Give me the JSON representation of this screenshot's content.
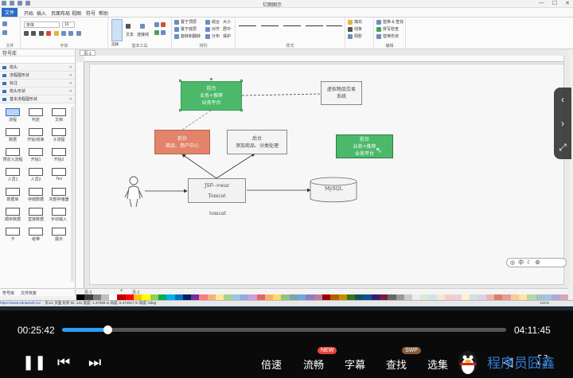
{
  "window": {
    "title": "亿图图示",
    "controls": [
      "—",
      "☐",
      "✕"
    ]
  },
  "menu": {
    "items": [
      "文件",
      "开始",
      "插入",
      "页面布局",
      "视图",
      "符号",
      "帮助"
    ],
    "active": 0
  },
  "ribbon": {
    "font_name": "宋体",
    "font_size": "10",
    "groups": [
      "文件",
      "字体",
      "基本工具",
      "排列",
      "样式",
      "编辑"
    ],
    "basic_tools": [
      "选择",
      "文本",
      "连接线"
    ],
    "arrange": [
      "置于顶层",
      "置于底层",
      "旋转和翻转",
      "组合",
      "对齐",
      "分布",
      "大小",
      "居中",
      "保护"
    ],
    "styles": [
      "填充",
      "线条",
      "阴影"
    ],
    "edit": [
      "替换 & 查找",
      "拼写检查",
      "替换形状"
    ]
  },
  "sidebar": {
    "title": "符号库",
    "libraries": [
      "箭头",
      "流程图形状",
      "标注",
      "箭头形状",
      "基本流程图形状"
    ],
    "shapes": [
      "流程",
      "判定",
      "文档",
      "数据",
      "开始/结束",
      "子流程",
      "预定义流程",
      "开始1",
      "开始2",
      "人员1",
      "人员2",
      "Yes",
      "数据库",
      "存储数据",
      "内部存储器",
      "顺序数据",
      "直接数据",
      "手动输入",
      "卡",
      "纸带",
      "展示"
    ],
    "bottom_tabs": [
      "符号库",
      "文件恢复"
    ]
  },
  "canvas": {
    "page_tab": "页-1",
    "nodes": {
      "front_top": [
        "前台",
        "业务+推荐",
        "业务平台"
      ],
      "system": [
        "虚拟物品交易",
        "系统"
      ],
      "front": [
        "前台",
        "商品、用户中心"
      ],
      "back": [
        "后台",
        "添加商品、分类处理"
      ],
      "front_right": [
        "前台",
        "业务+推荐",
        "业务平台"
      ],
      "jsp": "JSP-->war",
      "tomcat": "Tomcat",
      "mysql": "MySQL",
      "tomcat_label": "tomcat"
    }
  },
  "tabbar": {
    "pages": [
      "页-1",
      "页-1"
    ]
  },
  "statusbar": {
    "link": "https://www.edrawsoft.cn/",
    "text": "页1/1  页面  形状 ID: 131  宽度: 1.37058 in  高度: 0.474917 in  角度: 0deg",
    "zoom": "141%"
  },
  "player": {
    "current_time": "00:25:42",
    "total_time": "04:11:45",
    "progress": 0.102,
    "options": [
      "倍速",
      "流畅",
      "字幕",
      "查找",
      "选集"
    ],
    "badges": {
      "new": "NEW",
      "swp": "SWP"
    },
    "watermark": "程序员囧鑫"
  },
  "palette": [
    "#000000",
    "#3c3c3c",
    "#7f7f7f",
    "#bfbfbf",
    "#ffffff",
    "#c00000",
    "#ff0000",
    "#ffc000",
    "#ffff00",
    "#92d050",
    "#00b050",
    "#00b0f0",
    "#0070c0",
    "#002060",
    "#7030a0",
    "#ff7c80",
    "#f4b183",
    "#ffe699",
    "#a9d18e",
    "#9dc3e6",
    "#8faadc",
    "#c9a0dc",
    "#e06666",
    "#f6b26b",
    "#ffd966",
    "#93c47d",
    "#76a5af",
    "#6fa8dc",
    "#8e7cc3",
    "#c27ba0",
    "#990000",
    "#b45f06",
    "#bf9000",
    "#38761d",
    "#134f5c",
    "#0b5394",
    "#351c75",
    "#741b47",
    "#666666",
    "#999999",
    "#cccccc",
    "#eeeeee",
    "#d9ead3",
    "#cfe2f3",
    "#fce5cd",
    "#f4cccc",
    "#ead1dc",
    "#fff2cc",
    "#d0e0e3",
    "#d9d2e9",
    "#e6b8af",
    "#dd7e6b",
    "#ea9999",
    "#f9cb9c",
    "#ffe599",
    "#b6d7a8",
    "#a2c4c9",
    "#9fc5e8",
    "#b4a7d6",
    "#d5a6bd"
  ]
}
